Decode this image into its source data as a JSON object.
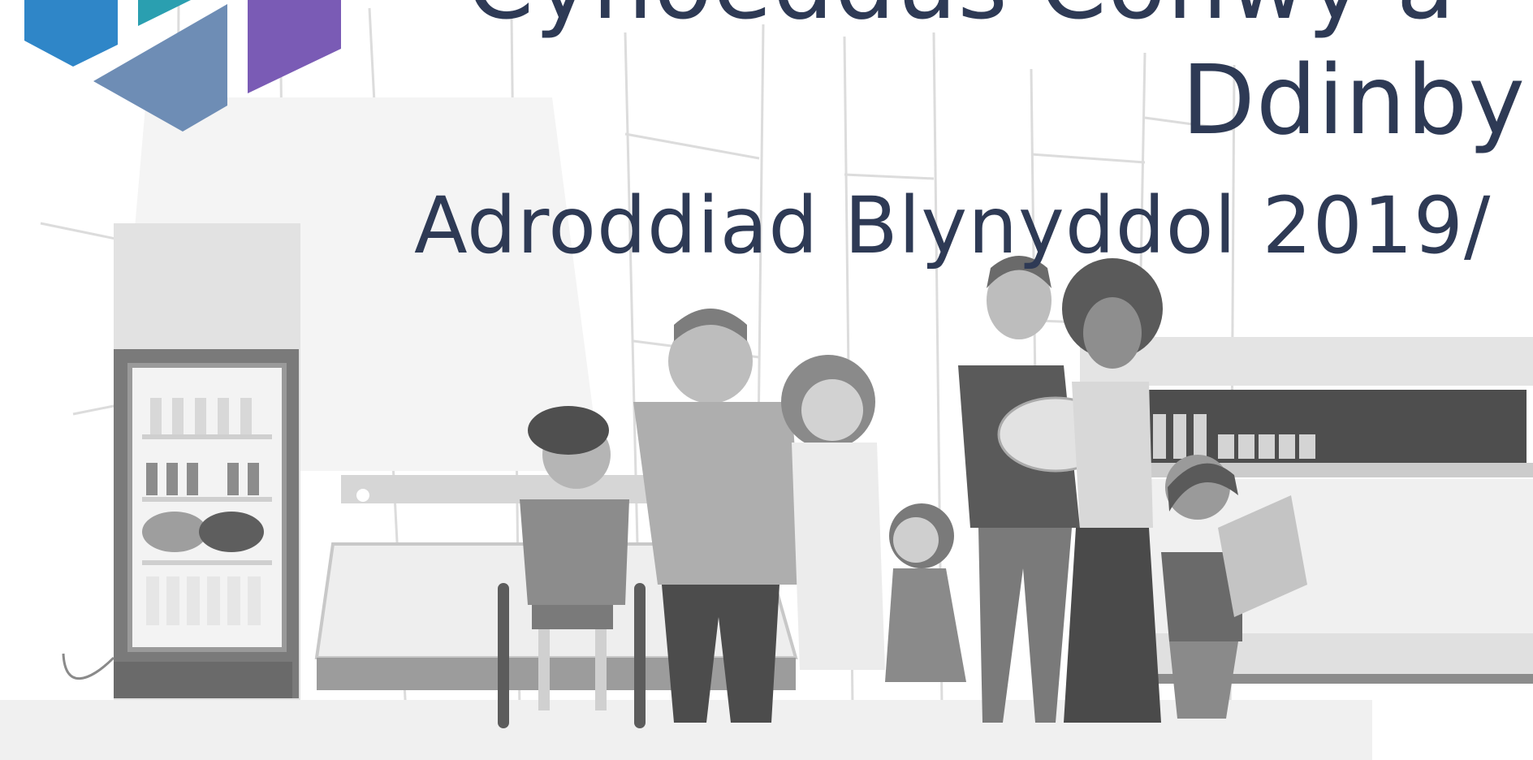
{
  "slide": {
    "title_line_1": "Cynoeddus Conwy a",
    "title_line_2": "Ddinby",
    "subtitle": "Adroddiad Blynyddol 2019/"
  },
  "colors": {
    "title_text": "#2e3a55",
    "logo_blue": "#2f86c8",
    "logo_teal": "#2a9fb0",
    "logo_slate": "#6e8db5",
    "logo_purple": "#7a5bb5",
    "illustration_gray": "#9a9a9a"
  },
  "icons": {
    "logo": "hexagon-logo-icon"
  }
}
